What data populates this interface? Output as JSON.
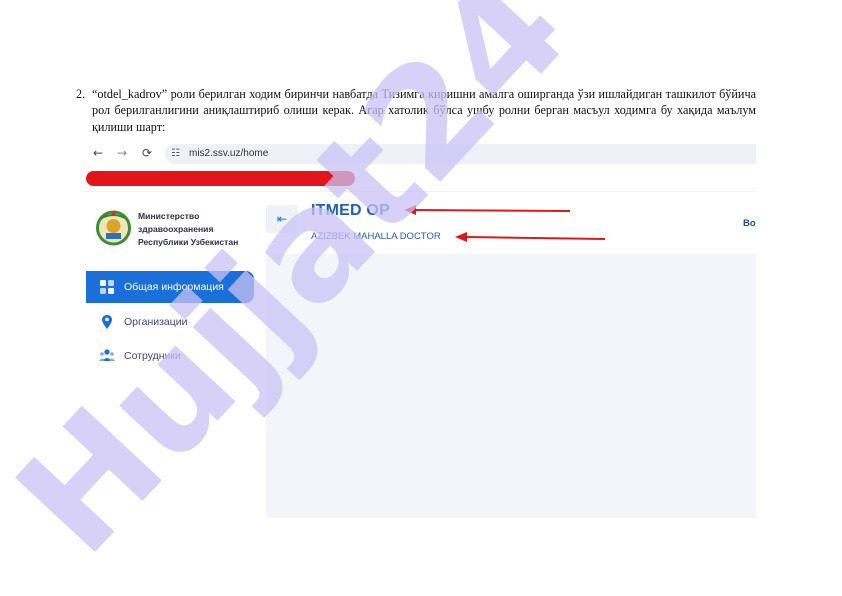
{
  "document": {
    "item_number": "2.",
    "paragraph": "“otdel_kadrov” роли берилган ходим биринчи навбатда Тизимга киришни амалга оширганда ўзи ишлайдиган ташкилот бўйича рол берилганлигини аниқлаштириб олиши керак. Агар хатолик бўлса ушбу ролни берган масъул ходимга бу хақида маълум қилиши шарт:"
  },
  "screenshot": {
    "browser": {
      "back_icon": "arrow-left-icon",
      "forward_icon": "arrow-right-icon",
      "reload_icon": "reload-icon",
      "site_settings_icon": "tune-icon",
      "url": "mis2.ssv.uz/home"
    },
    "redaction_color": "#e4141b",
    "sidebar": {
      "org_name_lines": [
        "Министерство",
        "здравоохранения",
        "Республики Узбекистан"
      ],
      "items": [
        {
          "label": "Общая информация",
          "icon": "grid-icon",
          "active": true
        },
        {
          "label": "Организации",
          "icon": "location-pin-icon",
          "active": false
        },
        {
          "label": "Сотрудники",
          "icon": "users-icon",
          "active": false
        }
      ]
    },
    "header": {
      "collapse_icon": "collapse-left-icon",
      "title": "ITMED OP",
      "subtitle": "AZIZBEK MAHALLA DOCTOR",
      "right_text": "Bo"
    },
    "annotation_arrow_color": "#d81b1b",
    "accent_color": "#1b6fd8"
  },
  "watermark": {
    "text": "Hujjat24",
    "color": "#c9c2f5"
  }
}
